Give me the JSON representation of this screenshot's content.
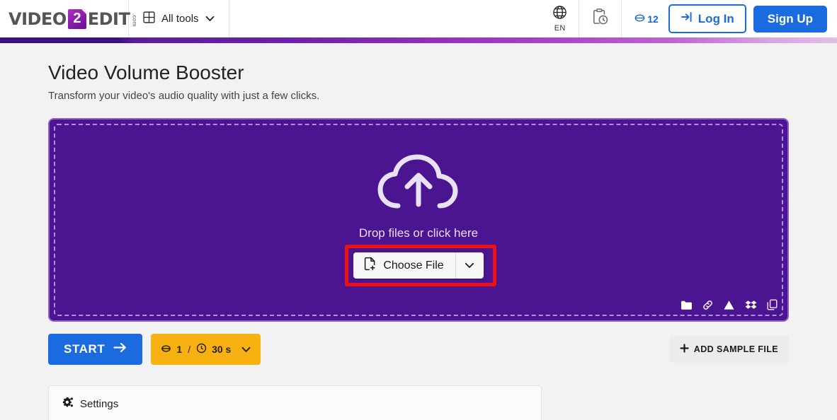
{
  "header": {
    "logo": {
      "word1": "VIDEO",
      "tile": "2",
      "word2": "EDIT",
      "dotcom": ".com"
    },
    "all_tools": {
      "label": "All tools",
      "icon": "grid-icon",
      "caret": "chevron-down-icon"
    },
    "language": {
      "label": "EN",
      "icon": "globe-icon"
    },
    "file_history": {
      "icon": "clipboard-clock-icon"
    },
    "credits": {
      "value": "12",
      "icon": "credit-coin-icon"
    },
    "login": {
      "label": "Log In",
      "icon": "login-arrow-icon"
    },
    "signup": {
      "label": "Sign Up"
    }
  },
  "main": {
    "title": "Video Volume Booster",
    "subtitle": "Transform your video's audio quality with just a few clicks.",
    "dropzone": {
      "icon": "cloud-upload-icon",
      "text": "Drop files or click here",
      "choose_file": {
        "label": "Choose File",
        "icon": "file-add-icon",
        "caret": "chevron-down-icon"
      },
      "services": [
        {
          "name": "folder-icon"
        },
        {
          "name": "link-icon"
        },
        {
          "name": "google-drive-icon"
        },
        {
          "name": "dropbox-icon"
        },
        {
          "name": "clipboard-copy-icon"
        }
      ]
    },
    "actions": {
      "start": {
        "label": "START",
        "icon": "arrow-right-icon"
      },
      "credits_badge": {
        "credits": "1",
        "separator": "/",
        "duration": "30 s",
        "coin_icon": "credit-coin-icon",
        "clock_icon": "clock-icon",
        "caret": "chevron-down-icon"
      },
      "add_sample": {
        "label": "ADD SAMPLE FILE",
        "icon": "plus-icon"
      }
    },
    "settings": {
      "label": "Settings",
      "icon": "gears-icon"
    }
  },
  "colors": {
    "accent_blue": "#1a6ae0",
    "dropzone_purple": "#4b1490",
    "badge_orange": "#f7b211",
    "highlight_red": "#ee1111"
  }
}
